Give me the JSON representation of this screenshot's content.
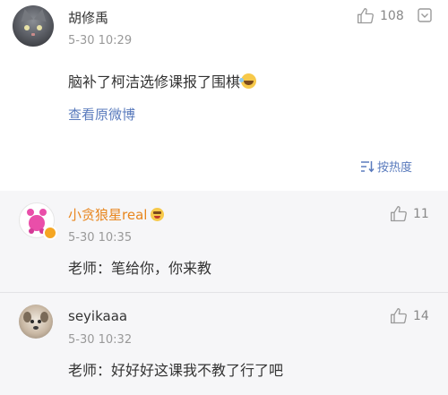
{
  "main_comment": {
    "username": "胡修禹",
    "timestamp": "5-30 10:29",
    "text": "脑补了柯洁选修课报了围棋",
    "like_count": "108",
    "view_original_label": "查看原微博",
    "sort_label": "按热度"
  },
  "replies": [
    {
      "username": "小贪狼星real",
      "timestamp": "5-30 10:35",
      "text": "老师：笔给你，你来教",
      "like_count": "11"
    },
    {
      "username": "seyikaaa",
      "timestamp": "5-30 10:32",
      "text": "老师：好好好这课我不教了行了吧",
      "like_count": "14"
    }
  ],
  "colors": {
    "link_blue": "#5a7bbd",
    "member_orange": "#e8861e",
    "meta_gray": "#999999",
    "reply_background": "#f6f6f8"
  },
  "icons": [
    "thumbs-up-icon",
    "chevron-down-icon",
    "sort-icon",
    "laugh-emoji-icon",
    "member-emoji-icon",
    "vip-badge-icon"
  ]
}
